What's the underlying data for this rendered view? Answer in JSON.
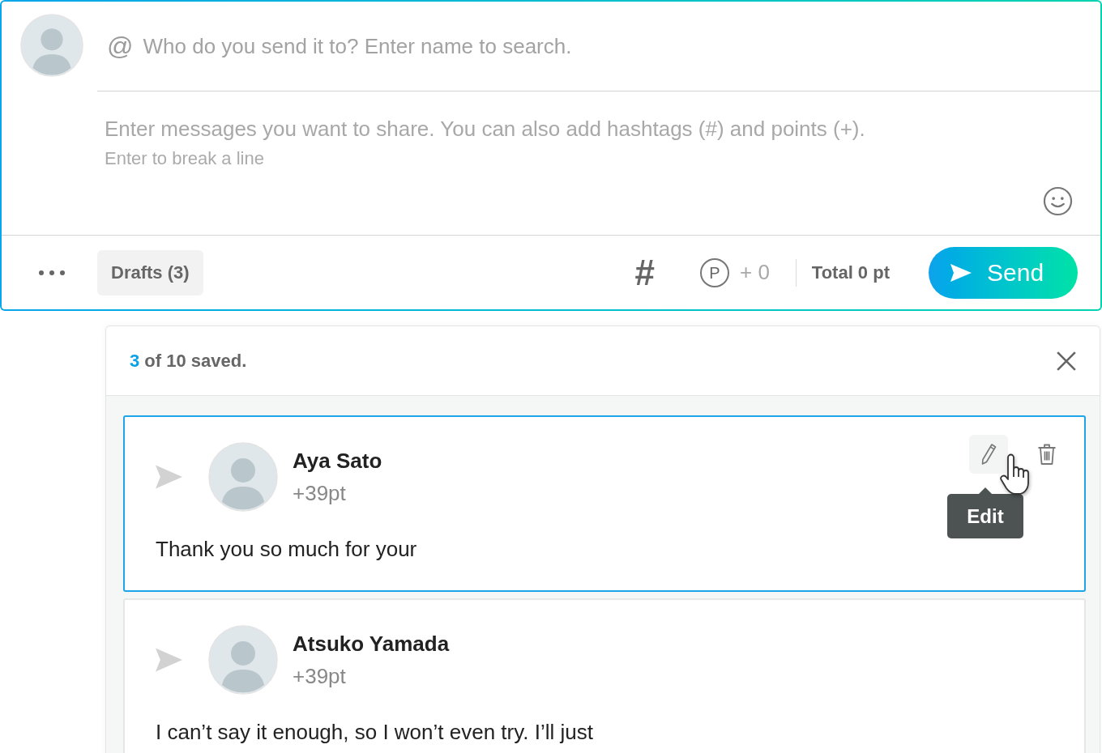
{
  "composer": {
    "recipient_field": {
      "symbol": "@",
      "placeholder": "Who do you send it to? Enter name to search."
    },
    "message_field": {
      "placeholder": "Enter messages you want to share. You can also add hashtags (#) and points (+).",
      "hint": "Enter to break a line"
    },
    "toolbar": {
      "drafts_button": "Drafts (3)",
      "hashtag_button": "#",
      "points": {
        "symbol": "P",
        "added": "+ 0"
      },
      "total": "Total 0 pt",
      "send_button": "Send"
    }
  },
  "drafts_panel": {
    "saved_count": "3",
    "saved_text": "of 10 saved.",
    "drafts": [
      {
        "name": "Aya Sato",
        "points": "+39pt",
        "message": "Thank you so much for your",
        "hovered": true,
        "tooltip": "Edit"
      },
      {
        "name": "Atsuko Yamada",
        "points": "+39pt",
        "message": "I can’t say it enough, so I won’t even try. I’ll just",
        "hovered": false
      }
    ]
  }
}
